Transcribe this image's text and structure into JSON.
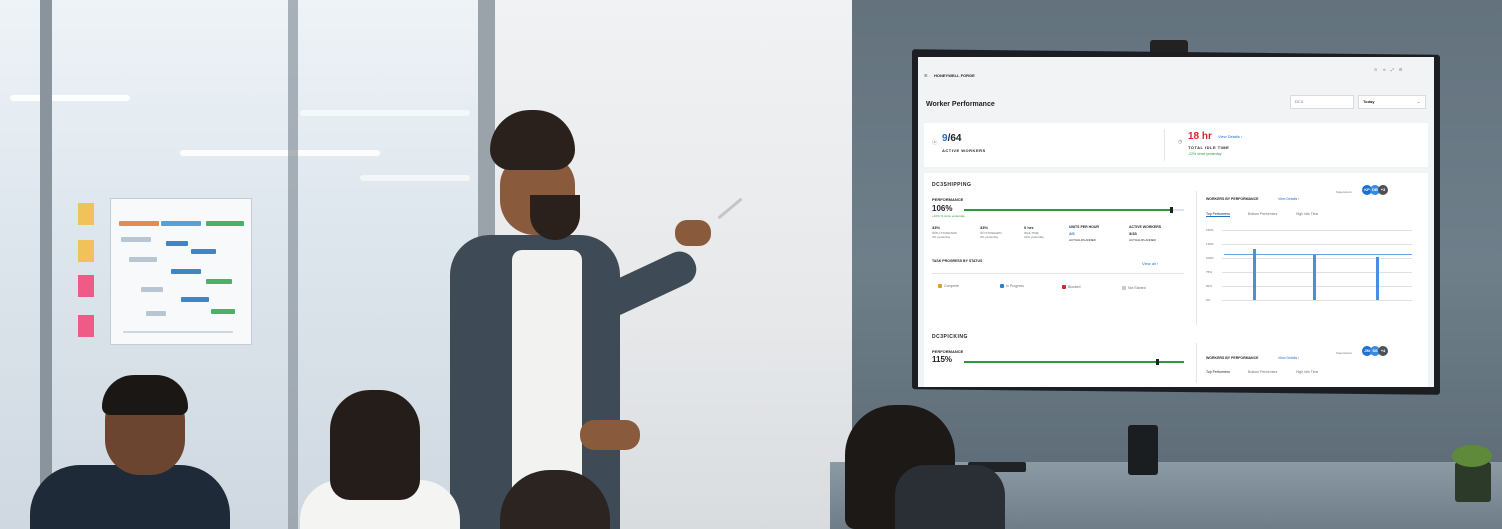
{
  "dashboard": {
    "brand": "HONEYWELL FORGE",
    "page_title": "Worker Performance",
    "filter_site": "DC3",
    "filter_period": "Today",
    "kpis": {
      "active_workers_value": "9",
      "active_workers_total": "/64",
      "active_workers_label": "ACTIVE WORKERS",
      "idle_time_value": "18 hr",
      "idle_time_link": "View Details  ›",
      "idle_time_label": "TOTAL IDLE TIME",
      "idle_time_note": "-22% since yesterday"
    },
    "section1": {
      "title": "DC3SHIPPING",
      "performance_label": "PERFORMANCE",
      "performance_value": "106%",
      "performance_note": "+10% % since yesterday",
      "stats": [
        {
          "value": "33%",
          "label": "WITH STANDARD",
          "note": "4% yesterday"
        },
        {
          "value": "33%",
          "label": "ON STANDARD",
          "note": "3% yesterday"
        },
        {
          "value": "0 hrs",
          "label": "IDLE TIME",
          "note": "22% yesterday"
        },
        {
          "value": "2/0",
          "label": "UNITS PER HOUR",
          "sub": "ACTUAL/PLANNED"
        },
        {
          "value": "3/33",
          "label": "ACTIVE WORKERS",
          "sub": "ACTUAL/PLANNED"
        }
      ],
      "task_progress_label": "TASK PROGRESS BY STATUS",
      "view_all": "View all  ›",
      "legend": [
        "Complete",
        "In Progress",
        "Blocked",
        "Not Started"
      ],
      "legend_colors": [
        "#d9a321",
        "#2f7fd0",
        "#d8262f",
        "#c7ccd1"
      ],
      "workers_by_performance": "WORKERS BY PERFORMANCE",
      "view_details": "View Details  ›",
      "supervisors_label": "Supervisors",
      "supervisors": [
        "KP",
        "DB",
        "+3"
      ],
      "tabs": [
        "Top Performers",
        "Bottom Performers",
        "High Idle Time"
      ],
      "y_ticks": [
        "150%",
        "125%",
        "100%",
        "75%",
        "50%",
        "0%"
      ]
    },
    "section2": {
      "title": "DC3PICKING",
      "performance_label": "PERFORMANCE",
      "performance_value": "115%",
      "workers_by_performance": "WORKERS BY PERFORMANCE",
      "view_details": "View Details  ›",
      "supervisors_label": "Supervisors",
      "supervisors": [
        "JM",
        "SS",
        "+4"
      ],
      "tabs": [
        "Top Performers",
        "Bottom Performers",
        "High Idle Time"
      ]
    }
  },
  "colors": {
    "accent_blue": "#1f6fd1",
    "alert_red": "#d8262f",
    "progress_green": "#2b9a3e"
  }
}
